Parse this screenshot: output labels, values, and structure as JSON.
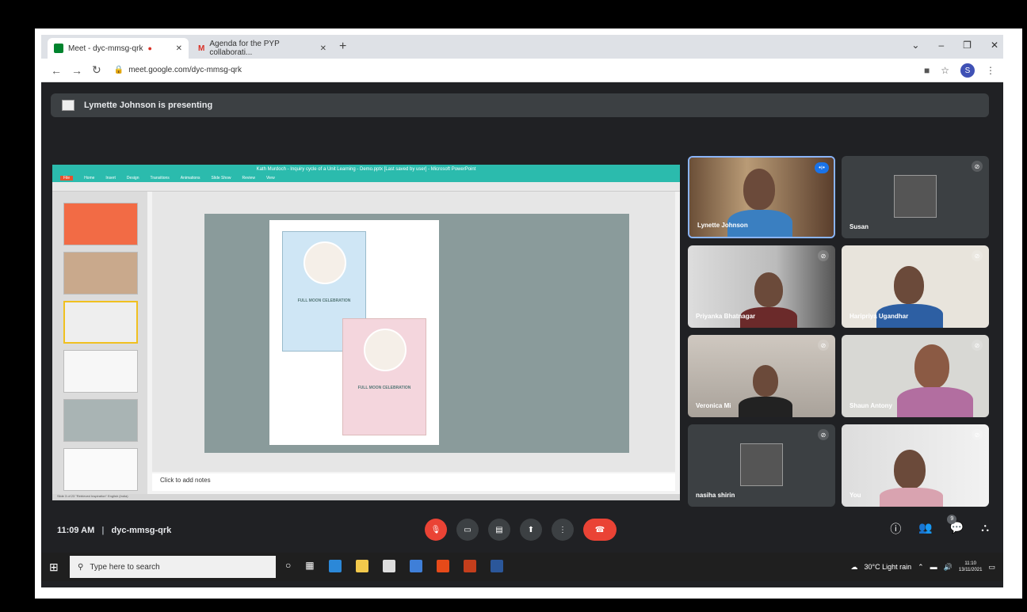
{
  "browser": {
    "tabs": [
      {
        "label": "Meet - dyc-mmsg-qrk"
      },
      {
        "label": "Agenda for the PYP collaborati..."
      }
    ],
    "new_tab": "+",
    "url": "meet.google.com/dyc-mmsg-qrk",
    "profile_initial": "S"
  },
  "meet": {
    "presenting_text": "Lymette Johnson is presenting",
    "time": "11:09 AM",
    "meeting_code": "dyc-mmsg-qrk",
    "participant_count": "9",
    "participants": [
      {
        "name": "Lynette Johnson"
      },
      {
        "name": "Susan"
      },
      {
        "name": "Priyanka Bhatnagar"
      },
      {
        "name": "Haripriya Ugandhar"
      },
      {
        "name": "Veronica Mi"
      },
      {
        "name": "Shaun Antony"
      },
      {
        "name": "nasiha shirin"
      },
      {
        "name": "You"
      }
    ]
  },
  "ppt": {
    "title": "Kath Murdoch - Inquiry cycle of a Unit Learning - Demo.pptx [Last saved by user] - Microsoft PowerPoint",
    "menu": [
      "File",
      "Home",
      "Insert",
      "Design",
      "Transitions",
      "Animations",
      "Slide Show",
      "Review",
      "View"
    ],
    "notes_placeholder": "Click to add notes",
    "status": "Slide 3 of 23   \"Retrieved Inspiration\"   English (India)",
    "invite1_title": "FULL MOON CELEBRATION",
    "invite2_title": "FULL MOON CELEBRATION"
  },
  "taskbar": {
    "search_placeholder": "Type here to search",
    "weather": "30°C  Light rain",
    "clock_time": "11:10",
    "clock_date": "13/11/2021"
  },
  "colors": {
    "meet_bg": "#202124",
    "leave_red": "#ea4335",
    "ppt_teal": "#2bbbad"
  }
}
